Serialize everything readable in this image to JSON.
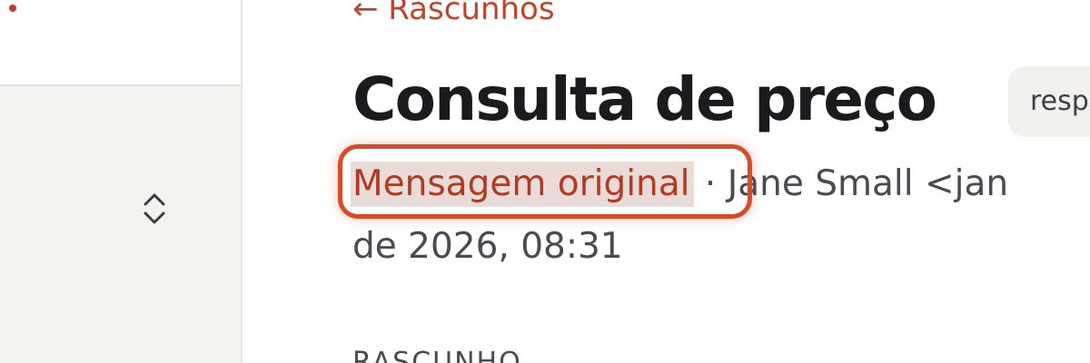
{
  "sidebar": {
    "sort_icon": "chevron-up-down-icon"
  },
  "header": {
    "back_link": "← Rascunhos"
  },
  "message": {
    "title": "Consulta de preço",
    "tag_label": "resp",
    "original_link": "Mensagem original",
    "separator": "·",
    "sender": "Jane Small <jan",
    "date": "de 2026, 08:31"
  },
  "section": {
    "label": "RASCUNHO"
  },
  "colors": {
    "accent": "#c0432a",
    "highlight_ring": "#d94a27",
    "title": "#1b1b1f",
    "muted_text": "#4a4a52"
  }
}
